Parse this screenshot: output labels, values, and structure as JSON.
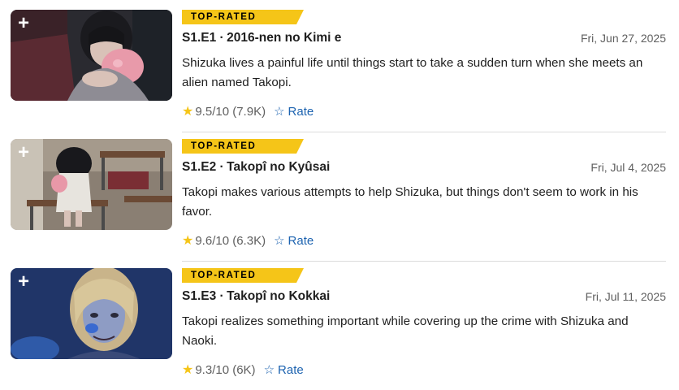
{
  "episodes": [
    {
      "badge": "TOP-RATED",
      "title": "S1.E1 ∙ 2016-nen no Kimi e",
      "date": "Fri, Jun 27, 2025",
      "description": "Shizuka lives a painful life until things start to take a sudden turn when she meets an alien named Takopi.",
      "rating": "9.5/10 (7.9K)",
      "rate_label": "Rate",
      "watchlist_symbol": "+"
    },
    {
      "badge": "TOP-RATED",
      "title": "S1.E2 ∙ Takopî no Kyûsai",
      "date": "Fri, Jul 4, 2025",
      "description": "Takopi makes various attempts to help Shizuka, but things don't seem to work in his favor.",
      "rating": "9.6/10 (6.3K)",
      "rate_label": "Rate",
      "watchlist_symbol": "+"
    },
    {
      "badge": "TOP-RATED",
      "title": "S1.E3 ∙ Takopî no Kokkai",
      "date": "Fri, Jul 11, 2025",
      "description": "Takopi realizes something important while covering up the crime with Shizuka and Naoki.",
      "rating": "9.3/10 (6K)",
      "rate_label": "Rate",
      "watchlist_symbol": "+"
    }
  ],
  "icons": {
    "rating": "star-icon",
    "rate": "star-outline-icon",
    "watchlist": "plus-icon"
  },
  "colors": {
    "badge": "#f5c518",
    "star": "#f5c518",
    "link": "#1d63b0"
  }
}
